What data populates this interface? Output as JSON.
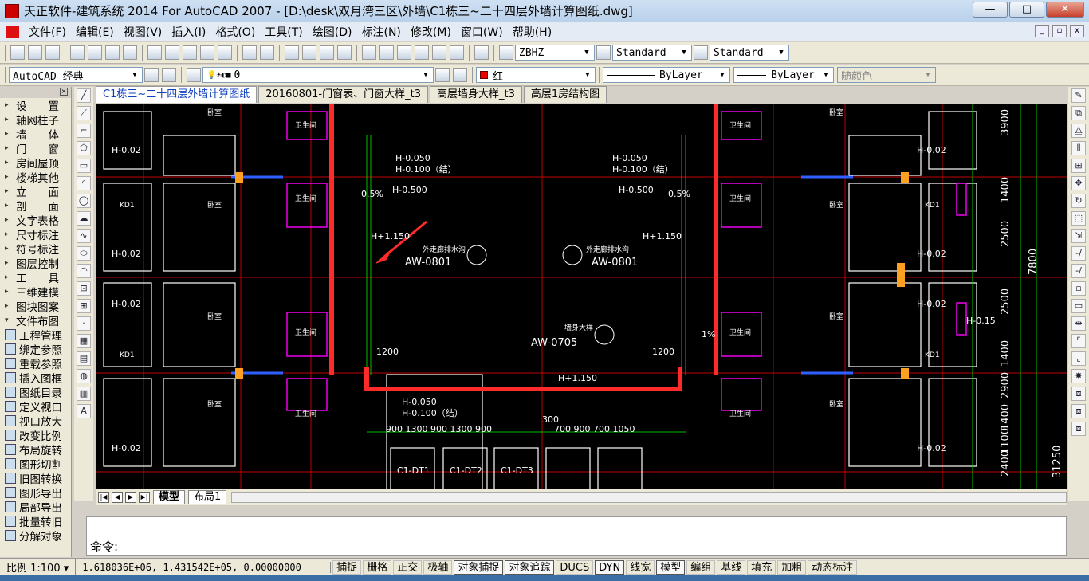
{
  "window": {
    "title": "天正软件-建筑系统 2014  For AutoCAD 2007 - [D:\\desk\\双月湾三区\\外墙\\C1栋三~二十四层外墙计算图纸.dwg]",
    "minimize": "—",
    "maximize": "□",
    "close": "✕"
  },
  "menubar": {
    "items": [
      "文件(F)",
      "编辑(E)",
      "视图(V)",
      "插入(I)",
      "格式(O)",
      "工具(T)",
      "绘图(D)",
      "标注(N)",
      "修改(M)",
      "窗口(W)",
      "帮助(H)"
    ]
  },
  "toolbar1": {
    "textstyle": "ZBHZ",
    "dimstyle": "Standard",
    "tablestyle": "Standard"
  },
  "toolbar2": {
    "workspace": "AutoCAD 经典",
    "layer": "0",
    "color": "红",
    "linetype": "ByLayer",
    "lineweight": "ByLayer",
    "plotstyle": "随颜色"
  },
  "tabs": [
    "C1栋三~二十四层外墙计算图纸",
    "20160801-门窗表、门窗大样_t3",
    "高层墙身大样_t3",
    "高层1房结构图"
  ],
  "leftpanel": {
    "items": [
      {
        "arr": "▸",
        "label": "设　　置"
      },
      {
        "arr": "▸",
        "label": "轴网柱子"
      },
      {
        "arr": "▸",
        "label": "墙　　体"
      },
      {
        "arr": "▸",
        "label": "门　　窗"
      },
      {
        "arr": "▸",
        "label": "房间屋顶"
      },
      {
        "arr": "▸",
        "label": "楼梯其他"
      },
      {
        "arr": "▸",
        "label": "立　　面"
      },
      {
        "arr": "▸",
        "label": "剖　　面"
      },
      {
        "arr": "▸",
        "label": "文字表格"
      },
      {
        "arr": "▸",
        "label": "尺寸标注"
      },
      {
        "arr": "▸",
        "label": "符号标注"
      },
      {
        "arr": "▸",
        "label": "图层控制"
      },
      {
        "arr": "▸",
        "label": "工　　具"
      },
      {
        "arr": "▸",
        "label": "三维建模"
      },
      {
        "arr": "▸",
        "label": "图块图案"
      },
      {
        "arr": "▾",
        "label": "文件布图"
      }
    ],
    "subitems": [
      "工程管理",
      "绑定参照",
      "重载参照",
      "插入图框",
      "图纸目录",
      "定义视口",
      "视口放大",
      "改变比例",
      "布局旋转",
      "图形切割",
      "旧图转换",
      "图形导出",
      "局部导出",
      "批量转旧",
      "分解对象"
    ]
  },
  "drawing": {
    "labels": {
      "aw1": "AW-0801",
      "aw2": "AW-0801",
      "aw3": "AW-0705",
      "note1": "外走廊排水沟",
      "note2": "外走廊排水沟",
      "note3": "墙身大样",
      "h1150a": "H+1.150",
      "h1150b": "H+1.150",
      "h1150c": "H+1.150",
      "h0500a": "H-0.500",
      "h0500b": "H-0.500",
      "h0050a": "H-0.050",
      "h0100a": "H-0.100（结）",
      "h0050b": "H-0.050",
      "h0100b": "H-0.100（结）",
      "h0050c": "H-0.050",
      "h0100c": "H-0.100（结）",
      "d1200a": "1200",
      "d1200b": "1200",
      "p05": "0.5%",
      "p1": "1%",
      "dims_right": [
        "3900",
        "1400",
        "2500",
        "7800",
        "2500",
        "1400",
        "2900",
        "1400",
        "1100",
        "2400",
        "31250"
      ],
      "h015": "H-0.15",
      "room": "卫生间",
      "bed": "卧室",
      "kd1": "KD1",
      "h002": "H-0.02",
      "bottom_dims": "900  1300  900  1300  900",
      "dt1": "C1-DT1",
      "dt2": "C1-DT2",
      "dt3": "C1-DT3",
      "dim300": "300",
      "dim700": "700 900 700 1050"
    }
  },
  "layouttabs": [
    "模型",
    "布局1"
  ],
  "command": {
    "prompt": "命令:"
  },
  "statusbar": {
    "scale": "比例 1:100 ▾",
    "coords": "1.618036E+06, 1.431542E+05, 0.00000000",
    "buttons": [
      "捕捉",
      "栅格",
      "正交",
      "极轴",
      "对象捕捉",
      "对象追踪",
      "DUCS",
      "DYN",
      "线宽",
      "模型",
      "编组",
      "基线",
      "填充",
      "加粗",
      "动态标注"
    ]
  }
}
